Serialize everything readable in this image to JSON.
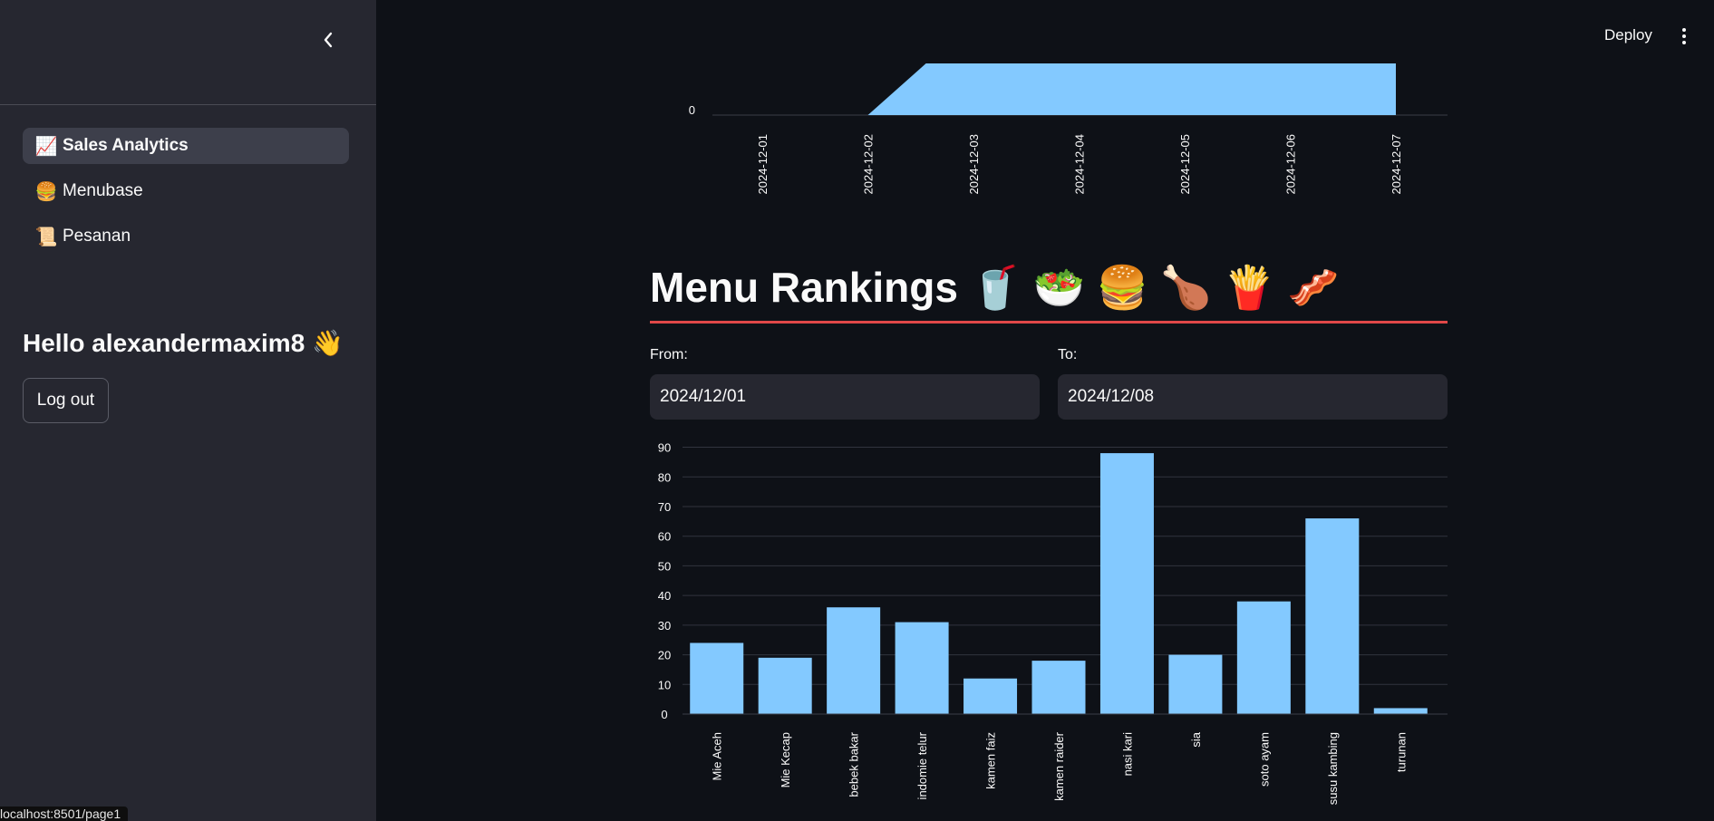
{
  "sidebar": {
    "items": [
      {
        "emoji": "📈",
        "label": "Sales Analytics",
        "active": true
      },
      {
        "emoji": "🍔",
        "label": "Menubase",
        "active": false
      },
      {
        "emoji": "📜",
        "label": "Pesanan",
        "active": false
      }
    ],
    "greeting": "Hello alexandermaxim8 👋",
    "logout_label": "Log out",
    "status_url": "localhost:8501/page1"
  },
  "header": {
    "deploy_label": "Deploy"
  },
  "main": {
    "section_title": "Menu Rankings 🥤 🥗 🍔 🍗 🍟 🥓",
    "from_label": "From:",
    "from_value": "2024/12/01",
    "to_label": "To:",
    "to_value": "2024/12/08"
  },
  "colors": {
    "accent_rule": "#e04848",
    "bar": "#83c9ff",
    "background": "#0e1117",
    "sidebar": "#262730"
  },
  "chart_data": [
    {
      "type": "area",
      "x": [
        "2024-12-01",
        "2024-12-02",
        "2024-12-03",
        "2024-12-04",
        "2024-12-05",
        "2024-12-06",
        "2024-12-07"
      ],
      "y_ticks_visible": [
        "0"
      ],
      "note_partial": true,
      "series": [
        {
          "points": [
            [
              "2024-12-01",
              0
            ],
            [
              "2024-12-02",
              0
            ],
            [
              "2024-12-02.55",
              1
            ],
            [
              "2024-12-07",
              1
            ],
            [
              "2024-12-07",
              0
            ]
          ]
        }
      ]
    },
    {
      "type": "bar",
      "categories": [
        "Mie Aceh",
        "Mie Kecap",
        "bebek bakar",
        "indomie telur",
        "kamen faiz",
        "kamen raider",
        "nasi kari",
        "sia",
        "soto ayam",
        "susu kambing",
        "turunan"
      ],
      "values": [
        24,
        19,
        36,
        31,
        12,
        18,
        88,
        20,
        38,
        66,
        2
      ],
      "yticks": [
        0,
        10,
        20,
        30,
        40,
        50,
        60,
        70,
        80,
        90
      ],
      "ylim": [
        0,
        92
      ],
      "grid": true
    }
  ]
}
